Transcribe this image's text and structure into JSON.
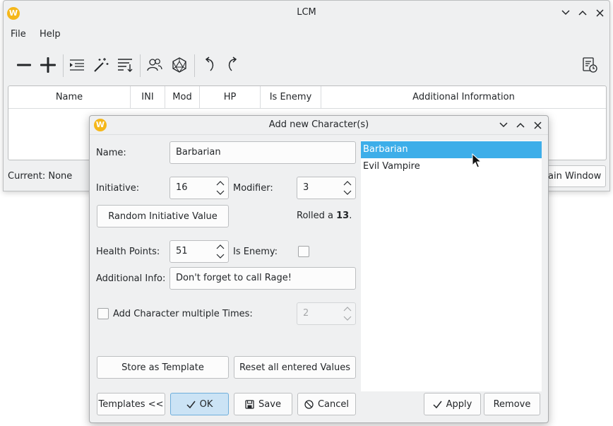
{
  "main_window": {
    "title": "LCM",
    "menu": [
      "File",
      "Help"
    ],
    "toolbar_icons": [
      "remove-icon",
      "add-icon",
      "insert-list-icon",
      "magic-wand-icon",
      "sort-icon",
      "users-icon",
      "dice-icon",
      "undo-icon",
      "redo-icon",
      "timer-icon"
    ],
    "table_headers": [
      "Name",
      "INI",
      "Mod",
      "HP",
      "Is Enemy",
      "Additional Information"
    ],
    "current_label": "Current: None",
    "main_window_button": "ain Window"
  },
  "dialog": {
    "title": "Add new Character(s)",
    "name_label": "Name:",
    "name_value": "Barbarian",
    "initiative_label": "Initiative:",
    "initiative_value": "16",
    "modifier_label": "Modifier:",
    "modifier_value": "3",
    "random_button": "Random Initiative Value",
    "rolled_prefix": "Rolled a ",
    "rolled_value": "13",
    "rolled_suffix": ".",
    "hp_label": "Health Points:",
    "hp_value": "51",
    "is_enemy_label": "Is Enemy:",
    "is_enemy_checked": false,
    "additional_label": "Additional Info:",
    "additional_value": "Don't forget to call Rage!",
    "multiple_label": "Add Character multiple Times:",
    "multiple_checked": false,
    "multiple_value": "2",
    "store_button": "Store as Template",
    "reset_button": "Reset all entered Values",
    "templates_button": "Templates <<",
    "ok_button": "OK",
    "save_button": "Save",
    "cancel_button": "Cancel",
    "apply_button": "Apply",
    "remove_button": "Remove",
    "templates": [
      {
        "name": "Barbarian",
        "selected": true
      },
      {
        "name": "Evil Vampire",
        "selected": false
      }
    ]
  },
  "colors": {
    "selection": "#3daee9",
    "window_bg": "#eff0f1",
    "logo": "#f5b71a"
  }
}
